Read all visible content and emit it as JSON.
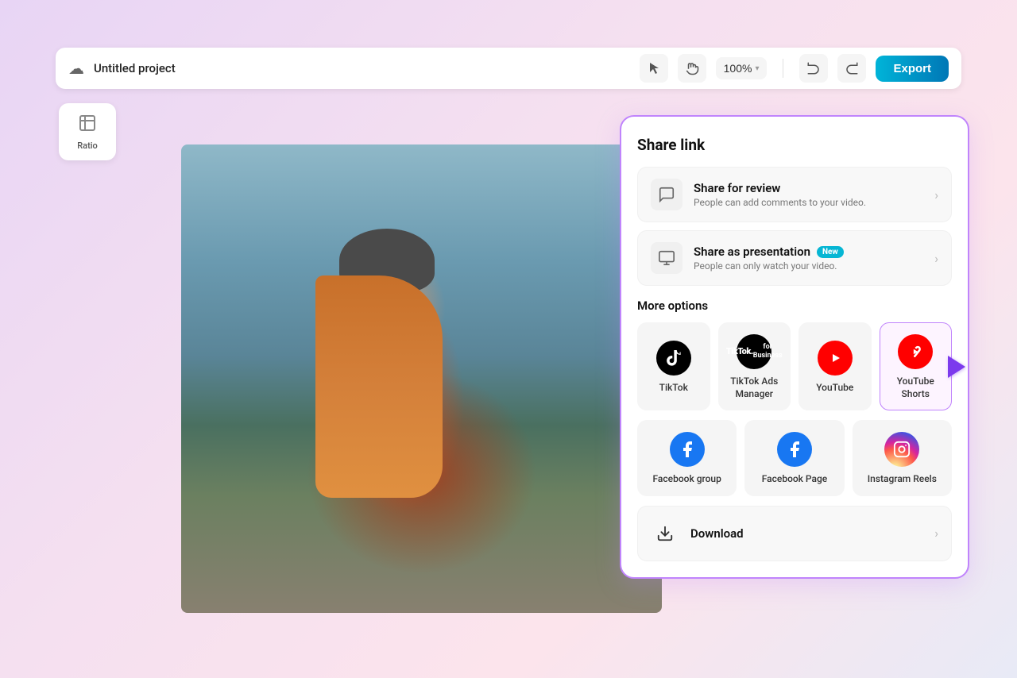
{
  "toolbar": {
    "project_title": "Untitled project",
    "zoom_level": "100%",
    "export_label": "Export"
  },
  "sidebar": {
    "ratio_label": "Ratio"
  },
  "share_panel": {
    "title": "Share link",
    "share_for_review": {
      "title": "Share for review",
      "description": "People can add comments to your video."
    },
    "share_as_presentation": {
      "title": "Share as presentation",
      "badge": "New",
      "description": "People can only watch your video."
    },
    "more_options_title": "More options",
    "platforms_row1": [
      {
        "label": "TikTok",
        "type": "tiktok"
      },
      {
        "label": "TikTok Ads Manager",
        "type": "tiktok-ads"
      },
      {
        "label": "YouTube",
        "type": "youtube"
      },
      {
        "label": "YouTube Shorts",
        "type": "youtube-shorts"
      }
    ],
    "platforms_row2": [
      {
        "label": "Facebook group",
        "type": "facebook"
      },
      {
        "label": "Facebook Page",
        "type": "facebook"
      },
      {
        "label": "Instagram Reels",
        "type": "instagram"
      }
    ],
    "download_label": "Download"
  }
}
